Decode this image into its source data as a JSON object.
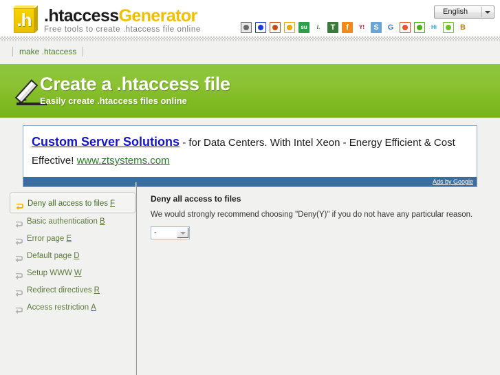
{
  "header": {
    "logo": {
      "box_letter": ".h",
      "title_part_a": ".htaccess",
      "title_part_b": "Generator",
      "subtitle": "Free tools to create .htaccess file online"
    },
    "language": {
      "selected": "English",
      "caret_icon": "chevron-down-icon"
    },
    "social_icons": [
      {
        "name": "addthis-icon",
        "glyph": "",
        "bg": "#e8e8e8",
        "fg": "#6b6b6b"
      },
      {
        "name": "delicious-icon",
        "glyph": "",
        "bg": "#ffffff",
        "fg": "#1a3fd0"
      },
      {
        "name": "digg-icon",
        "glyph": "",
        "bg": "#ffffff",
        "fg": "#c64c19"
      },
      {
        "name": "mixx-icon",
        "glyph": "",
        "bg": "#ffffff",
        "fg": "#f0a500"
      },
      {
        "name": "stumbleupon-icon",
        "glyph": "su",
        "bg": "#2e9e4c",
        "fg": "#ffffff"
      },
      {
        "name": "slashdot-icon",
        "glyph": "/.",
        "bg": "#ffffff",
        "fg": "#1c6b1c"
      },
      {
        "name": "technorati-icon",
        "glyph": "T",
        "bg": "#3c7a3c",
        "fg": "#ffffff"
      },
      {
        "name": "furl-icon",
        "glyph": "f",
        "bg": "#f08a1c",
        "fg": "#ffffff"
      },
      {
        "name": "yahoo-buzz-icon",
        "glyph": "Y!",
        "bg": "#ffffff",
        "fg": "#c8102e"
      },
      {
        "name": "simpy-icon",
        "glyph": "S",
        "bg": "#6aa5d8",
        "fg": "#ffffff"
      },
      {
        "name": "google-bookmarks-icon",
        "glyph": "G",
        "bg": "#ffffff",
        "fg": "#3b7fd4"
      },
      {
        "name": "newsvine-icon",
        "glyph": "",
        "bg": "#ffffff",
        "fg": "#e8552d"
      },
      {
        "name": "feed-play-icon",
        "glyph": "",
        "bg": "#ffffff",
        "fg": "#4caf18"
      },
      {
        "name": "hi5-icon",
        "glyph": "Hi",
        "bg": "#ffffff",
        "fg": "#2aa6e0"
      },
      {
        "name": "tailrank-icon",
        "glyph": "",
        "bg": "#ffffff",
        "fg": "#6cc024"
      },
      {
        "name": "blinklist-icon",
        "glyph": "B",
        "bg": "#ffffff",
        "fg": "#b8860b"
      }
    ]
  },
  "nav": {
    "items": [
      {
        "label": "make .htaccess"
      }
    ]
  },
  "banner": {
    "icon": "pencil-icon",
    "title": "Create a .htaccess file",
    "subtitle": "Easily create .htaccess files online",
    "bg_color": "#8cc63f"
  },
  "ad": {
    "title": "Custom Server Solutions",
    "body": " - for Data Centers. With Intel Xeon - Energy Efficient & Cost Effective! ",
    "url": "www.ztsystems.com",
    "footer_label": "Ads by Google",
    "footer_color": "#3b6e9f"
  },
  "sidebar": {
    "items": [
      {
        "label": "Deny all access to files",
        "key": "F",
        "active": true,
        "icon": "arrow-return-icon"
      },
      {
        "label": "Basic authentication",
        "key": "B",
        "active": false,
        "icon": "arrow-return-icon"
      },
      {
        "label": "Error page",
        "key": "E",
        "active": false,
        "icon": "arrow-return-icon"
      },
      {
        "label": "Default page",
        "key": "D",
        "active": false,
        "icon": "arrow-return-icon"
      },
      {
        "label": "Setup WWW",
        "key": "W",
        "active": false,
        "icon": "arrow-return-icon"
      },
      {
        "label": "Redirect directives",
        "key": "R",
        "active": false,
        "icon": "arrow-return-icon"
      },
      {
        "label": "Access restriction",
        "key": "A",
        "active": false,
        "icon": "arrow-return-icon"
      }
    ]
  },
  "main": {
    "title": "Deny all access to files",
    "description": "We would strongly recommend choosing \"Deny(Y)\" if you do not have any particular reason.",
    "answer": {
      "selected": "-",
      "caret_icon": "chevron-down-icon"
    }
  }
}
